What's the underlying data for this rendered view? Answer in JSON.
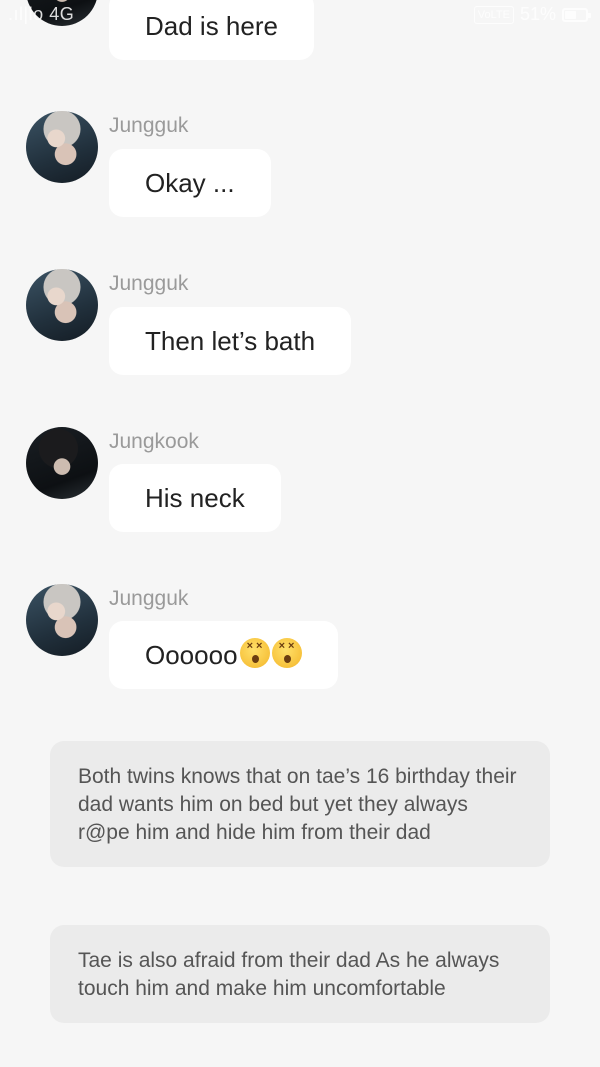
{
  "status_bar": {
    "carrier": ".ıl|lo 4G",
    "network_badge": "VoLTE",
    "battery": "51%",
    "battery_level": 0.51
  },
  "messages": [
    {
      "sender": "",
      "text": "Dad is here",
      "avatar": "avatar-dad"
    },
    {
      "sender": "Jungguk",
      "text": "Okay ...",
      "avatar": "avatar-jungguk"
    },
    {
      "sender": "Jungguk",
      "text": "Then let’s bath",
      "avatar": "avatar-jungguk"
    },
    {
      "sender": "Jungkook",
      "text": "His neck",
      "avatar": "avatar-jungkook"
    },
    {
      "sender": "Jungguk",
      "text": "Oooooo",
      "emojis": [
        "dizzy-face-emoji",
        "dizzy-face-emoji"
      ],
      "avatar": "avatar-jungguk"
    }
  ],
  "narrations": [
    "Both twins knows that on tae’s 16 birthday their dad wants him on bed but yet they always r@pe him and hide him from their dad",
    "Tae is also afraid from their dad As he always touch him and make him uncomfortable"
  ]
}
